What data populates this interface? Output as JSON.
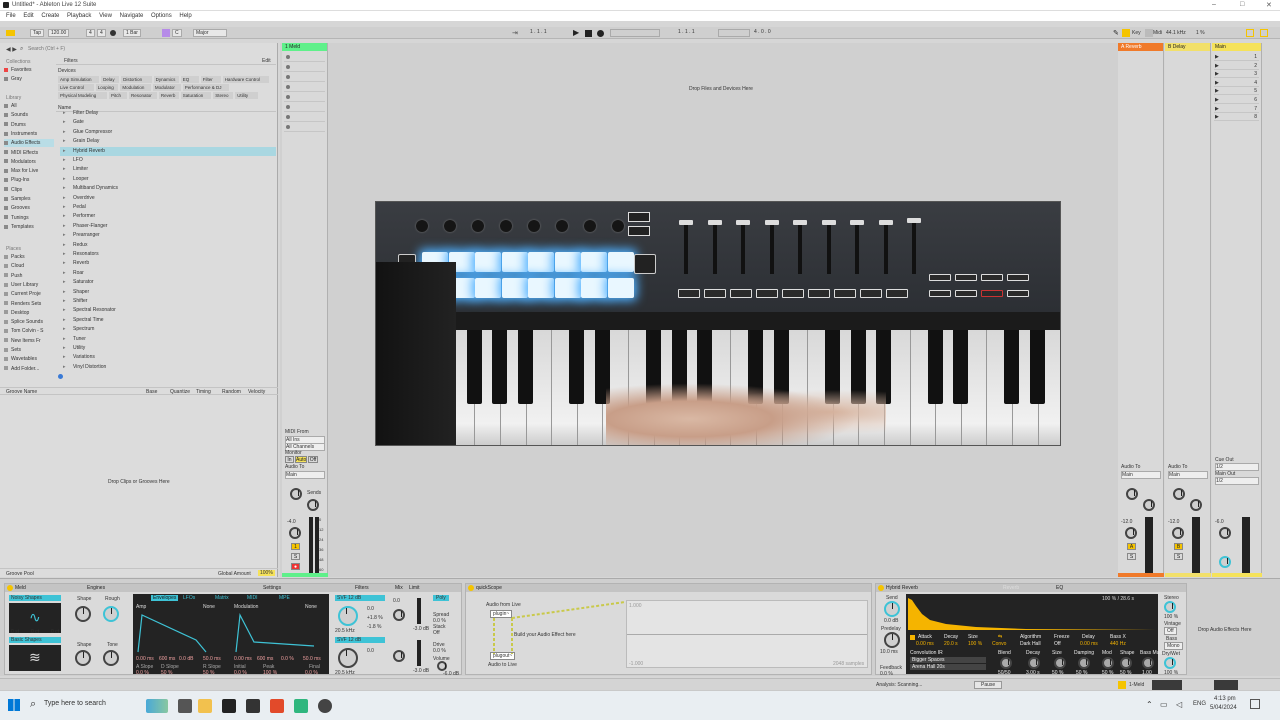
{
  "window": {
    "title": "Untitled* - Ableton Live 12 Suite"
  },
  "menu": [
    "File",
    "Edit",
    "Create",
    "Playback",
    "View",
    "Navigate",
    "Options",
    "Help"
  ],
  "transport": {
    "tap": "Tap",
    "tempo": "120.00",
    "meter_num": "4",
    "meter_den": "4",
    "quantize": "1 Bar",
    "key": "C",
    "scale": "Major",
    "position": "1 . 1 . 1",
    "loop_start": "1 . 1 . 1",
    "loop_length": "4 . 0 . 0",
    "key_label": "Key",
    "midi_label": "Midi",
    "sample_rate": "44.1 kHz",
    "cpu": "1 %"
  },
  "browser": {
    "search_placeholder": "Search (Ctrl + F)",
    "collections_label": "Collections",
    "collections": [
      "Favorites",
      "Gray"
    ],
    "library_label": "Library",
    "library_items": [
      "All",
      "Sounds",
      "Drums",
      "Instruments",
      "Audio Effects",
      "MIDI Effects",
      "Modulators",
      "Max for Live",
      "Plug-Ins",
      "Clips",
      "Samples",
      "Grooves",
      "Tunings",
      "Templates"
    ],
    "places_label": "Places",
    "places": [
      "Packs",
      "Cloud",
      "Push",
      "User Library",
      "Current Proje",
      "Renders Sets",
      "Desktop",
      "Splice Sounds",
      "Tom Colvin - S",
      "New Items Fr",
      "Sets",
      "Wavetables",
      "Add Folder..."
    ],
    "filters_label": "Filters",
    "filters_edit": "Edit",
    "devices_label": "Devices",
    "filter_chips": [
      "Amp Simulation",
      "Delay",
      "Distortion",
      "Dynamics",
      "EQ",
      "Filter",
      "Hardware Control",
      "Live Control",
      "Looping",
      "Modulation",
      "Modulator",
      "Performance & DJ",
      "Physical Modeling",
      "Pitch",
      "Resonator",
      "Reverb",
      "Saturation",
      "Stereo",
      "Utility"
    ],
    "name_header": "Name",
    "items": [
      "Filter Delay",
      "Gate",
      "Glue Compressor",
      "Grain Delay",
      "Hybrid Reverb",
      "LFO",
      "Limiter",
      "Looper",
      "Multiband Dynamics",
      "Overdrive",
      "Pedal",
      "Performer",
      "Phaser-Flanger",
      "Prearranger",
      "Redux",
      "Resonators",
      "Reverb",
      "Roar",
      "Saturator",
      "Shaper",
      "Shifter",
      "Spectral Resonator",
      "Spectral Time",
      "Spectrum",
      "Tuner",
      "Utility",
      "Variations",
      "Vinyl Distortion"
    ],
    "selected_item": "Hybrid Reverb",
    "groove_cols": [
      "Groove Name",
      "Base",
      "Quantize",
      "Timing",
      "Random",
      "Velocity"
    ],
    "groove_drop": "Drop Clips or Grooves Here",
    "groove_pool": "Groove Pool",
    "global_amount_label": "Global Amount",
    "global_amount": "100%"
  },
  "session": {
    "tracks": [
      {
        "name": "1 Meld",
        "color": "#5ff08a"
      }
    ],
    "returns": [
      {
        "name": "A Reverb",
        "color": "#f07a2a"
      },
      {
        "name": "B Delay",
        "color": "#f2e06a"
      }
    ],
    "main": {
      "name": "Main",
      "color": "#f5e25a"
    },
    "drop_text": "Drop Files and Devices Here",
    "scene_numbers": [
      "1",
      "2",
      "3",
      "4",
      "5",
      "6",
      "7",
      "8"
    ],
    "io": {
      "midi_from": "MIDI From",
      "all_ins": "All Ins",
      "all_channels": "All Channels",
      "monitor": "Monitor",
      "monitor_in": "In",
      "monitor_auto": "Auto",
      "monitor_off": "Off",
      "audio_to": "Audio To",
      "audio_to_val": "Main",
      "sends": "Sends",
      "cue_out": "Cue Out",
      "cue_val": "1/2",
      "main_out": "Main Out",
      "main_out_val": "1/2"
    },
    "track_vol": "-4.0",
    "return_a_vol": "-12.0",
    "return_b_vol": "-12.0",
    "main_vol": "-6.0",
    "meter_ticks": [
      "0",
      "12",
      "24",
      "36",
      "48",
      "60"
    ]
  },
  "devices": {
    "meld": {
      "title": "Meld",
      "engines": "Engines",
      "settings": "Settings",
      "osc_a": "Noisy Shapes",
      "osc_b": "Basic Shapes",
      "shape": "Shape",
      "rough": "Rough",
      "tone": "Tone",
      "zero_ct": "0 ct",
      "zero_st": "0 st",
      "tabs": [
        "Envelopes",
        "LFOs",
        "Matrix",
        "MIDI",
        "MPE"
      ],
      "amp": "Amp",
      "modulation": "Modulation",
      "none": "None",
      "attack": "0.00 ms",
      "decay": "600 ms",
      "sustain": "0.0 dB",
      "release": "50.0 ms",
      "slope_labels": [
        "A Slope",
        "D Slope",
        "R Slope"
      ],
      "slopes": [
        "0.0 %",
        "50 %",
        "50 %"
      ],
      "initial": "Initial",
      "peak": "Peak",
      "final": "Final",
      "mod_vals": [
        "0.0 %",
        "100 %",
        "0.0 %"
      ],
      "filters": "Filters",
      "mix": "Mix",
      "limit": "Limit",
      "filter_type": "SVF 12 dB",
      "filter_freq": "20.5 kHz",
      "res": "0.0",
      "plus": "+1.8 %",
      "minus": "-1.8 %",
      "mix_vals": [
        "0.0",
        "-3.0 dB",
        "-3.0 dB"
      ],
      "poly": "Poly",
      "spread": "Spread",
      "spread_val": "0.0 %",
      "stack": "Stack",
      "stack_val": "Off",
      "drive": "Drive",
      "drive_val": "0.0 %",
      "volume": "Volume",
      "volume_val": "-6.0 dB",
      "filter_b_freq": "20.5 kHz"
    },
    "quickscope": {
      "title": "quickScope",
      "audio_from": "Audio from Live",
      "plugin_in": "plugin~",
      "build_text": "Build your Audio Effect here",
      "plugout": "plugout~",
      "audio_to": "Audio to Live",
      "y_top": "1.000",
      "y_bottom": "-1.000",
      "samples": "2048 samples"
    },
    "hybrid": {
      "title": "Hybrid Reverb",
      "tab_reverb": "Reverb",
      "tab_eq": "EQ",
      "send": "Send",
      "send_val": "0.0 dB",
      "predelay": "Predelay",
      "predelay_val": "10.0 ms",
      "feedback": "Feedback",
      "feedback_val": "0.0 %",
      "ir_info": "100 % / 28.6 s",
      "attack": "Attack",
      "attack_val": "0.00 ms",
      "decay": "Decay",
      "decay_val": "20.0 s",
      "size": "Size",
      "size_val": "100 %",
      "convo": "Convo",
      "algorithm": "Algorithm",
      "algo_val": "Dark Hall",
      "freeze": "Freeze",
      "freeze_val": "Off",
      "delay": "Delay",
      "delay_val": "0.00 ms",
      "bass_x": "Bass X",
      "bass_x_val": "440 Hz",
      "conv_ir": "Convolution IR",
      "conv_cat": "Bigger Spaces",
      "conv_ir_name": "Arena Hall 20s",
      "blend": "Blend",
      "blend_val": "50/50",
      "decay2": "Decay",
      "decay2_val": "3.00 s",
      "size2": "Size",
      "size2_val": "50 %",
      "damping": "Damping",
      "damping_val": "50 %",
      "mod": "Mod",
      "mod_val": "50 %",
      "shape": "Shape",
      "shape_val": "50 %",
      "bass_mult": "Bass Mult",
      "bass_mult_val": "1.00",
      "stereo": "Stereo",
      "stereo_val": "100 %",
      "vintage": "Vintage",
      "vintage_val": "Off",
      "bass": "Bass",
      "bass_val": "Mono",
      "drywet": "Dry/Wet",
      "drywet_val": "100 %"
    },
    "drop_effects": "Drop Audio Effects Here"
  },
  "status": {
    "analysis": "Analysis: Scanning...",
    "pause": "Pause",
    "track": "1-Meld"
  },
  "taskbar": {
    "search_placeholder": "Type here to search",
    "lang": "ENG",
    "time": "4:13 pm",
    "date": "5/04/2024"
  },
  "colors": {
    "accent_blue": "#3ec3d6",
    "track_green": "#5ff08a",
    "return_orange": "#f07a2a",
    "main_yellow": "#f5e25a",
    "pad_glow": "#4fb0ff"
  }
}
